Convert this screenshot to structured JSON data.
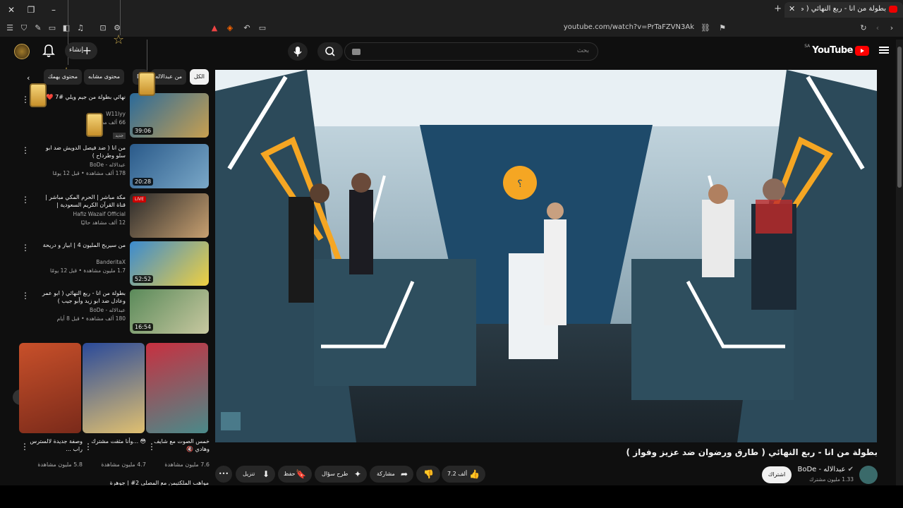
{
  "browser": {
    "tab_title": "بطولة من انا - ربع النهائي ( طارق و",
    "url": "youtube.com/watch?v=PrTaFZVN3Ak"
  },
  "header": {
    "logo_text": "YouTube",
    "country": "SA",
    "search_placeholder": "بحث",
    "create_label": "إنشاء"
  },
  "chips": [
    "الكل",
    "من عبدالاله",
    "BoDe",
    "محتوى مشابه",
    "محتوى يهمك"
  ],
  "sidebar": [
    {
      "title": "نهائي بطولة من جيم ويلي #7 ❤️ ...",
      "channel": "W11lyy",
      "meta": "66 ألف مشاهدة",
      "extra": "جديد",
      "duration": "39:06",
      "thumb": [
        "#2a6a9a",
        "#c8a050"
      ]
    },
    {
      "title": "من انا ( ضد فيصل الدويش ضد ابو سلو وطرداح )",
      "channel": "عبدالاله - BoDe",
      "meta": "178 ألف مشاهدة • قبل 12 يومًا",
      "duration": "20:28",
      "thumb": [
        "#2a5a8a",
        "#7aa8c8"
      ]
    },
    {
      "title": "مكة مباشر | الحرم المكي مباشر | قناة القرآن الكريم السعودية | Makkah Live",
      "channel": "Hafiz Wazaif Official",
      "meta": "12 ألف مشاهد حاليًا",
      "live": "LIVE",
      "thumb": [
        "#2a2a2a",
        "#c8a070"
      ]
    },
    {
      "title": "من سيربح المليون 4 | ابياز و دريحة",
      "channel": "BanderitaX",
      "meta": "1.7 مليون مشاهدة • قبل 12 يومًا",
      "duration": "52:52",
      "thumb": [
        "#3a8ad0",
        "#f0d040"
      ]
    },
    {
      "title": "بطولة من انا - ربع النهائي ( ابو عمر وعادل ضد ابو زيد وأبو جيب )",
      "channel": "عبدالاله - BoDe",
      "meta": "180 ألف مشاهدة • قبل 8 أيام",
      "duration": "16:54",
      "thumb": [
        "#5a8a5a",
        "#c8c8a0"
      ]
    }
  ],
  "shorts": [
    {
      "title": "خمس الصوت مع شايف وهادي 🔇",
      "views": "7.6 مليون مشاهدة",
      "thumb": [
        "#c83040",
        "#4a8a8a"
      ]
    },
    {
      "title": "😳 ...وأنا مثقت مشترك",
      "views": "4.7 مليون مشاهدة",
      "thumb": [
        "#2a4a9a",
        "#e0c070"
      ]
    },
    {
      "title": "وصفة جديدة لالسترس راب ...",
      "views": "5.8 مليون مشاهدة",
      "thumb": [
        "#c8502a",
        "#7a2a1a"
      ]
    }
  ],
  "next_item": "مواهب الملكتيمن مع المصلي 2# | جوهرة",
  "video": {
    "title": "بطولة من انا - ربع النهائي ( طارق ورضوان ضد عزيز وفواز )",
    "channel": "عبدالاله - BoDe",
    "subs": "1.33 مليون مشترك",
    "subscribe": "اشتراك",
    "likes": "7.2 ألف",
    "share": "مشاركة",
    "ask": "طرح سؤال",
    "save": "حفظ",
    "download": "تنزيل"
  },
  "colors": {
    "bg": "#0f0f0f",
    "accent": "#ff0000"
  }
}
